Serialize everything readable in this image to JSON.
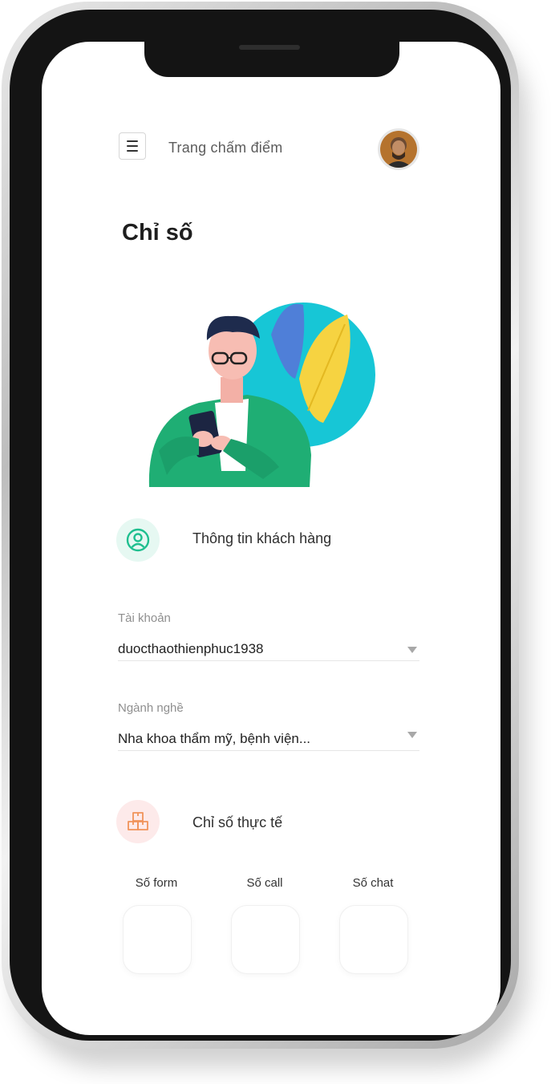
{
  "header": {
    "title": "Trang chấm điểm",
    "menu_icon": "hamburger-menu-icon",
    "avatar_icon": "user-avatar"
  },
  "page": {
    "heading": "Chỉ số"
  },
  "customer_section": {
    "label": "Thông tin khách hàng",
    "icon": "user-circle-icon",
    "icon_bg": "#e6f8f2",
    "icon_color": "#1fbf8f"
  },
  "fields": {
    "account": {
      "label": "Tài khoản",
      "value": "duocthaothienphuc1938"
    },
    "industry": {
      "label": "Ngành nghề",
      "value": "Nha khoa thẩm mỹ, bệnh viện..."
    }
  },
  "metrics_section": {
    "label": "Chỉ số thực tế",
    "icon": "boxes-icon",
    "icon_bg": "#fdeaea",
    "icon_color": "#f0935a"
  },
  "metrics": [
    {
      "label": "Số form",
      "value": ""
    },
    {
      "label": "Số call",
      "value": ""
    },
    {
      "label": "Số chat",
      "value": ""
    }
  ]
}
